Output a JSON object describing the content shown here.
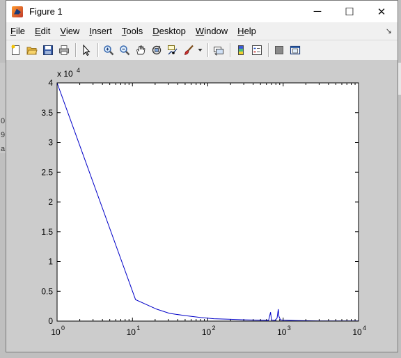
{
  "window": {
    "title": "Figure 1",
    "controls": {
      "minimize": "─",
      "maximize": "☐",
      "close": "✕"
    }
  },
  "menu": [
    {
      "prefix": "",
      "key": "F",
      "rest": "ile"
    },
    {
      "prefix": "",
      "key": "E",
      "rest": "dit"
    },
    {
      "prefix": "",
      "key": "V",
      "rest": "iew"
    },
    {
      "prefix": "",
      "key": "I",
      "rest": "nsert"
    },
    {
      "prefix": "",
      "key": "T",
      "rest": "ools"
    },
    {
      "prefix": "",
      "key": "D",
      "rest": "esktop"
    },
    {
      "prefix": "",
      "key": "W",
      "rest": "indow"
    },
    {
      "prefix": "",
      "key": "H",
      "rest": "elp"
    }
  ],
  "toolbar": {
    "buttons": [
      "new-figure-icon",
      "open-file-icon",
      "save-icon",
      "print-icon",
      "|",
      "edit-plot-arrow-icon",
      "|",
      "zoom-in-icon",
      "zoom-out-icon",
      "pan-hand-icon",
      "rotate-3d-icon",
      "data-cursor-icon",
      "brush-icon",
      "brush-dropdown-icon",
      "|",
      "link-plot-icon",
      "|",
      "insert-colorbar-icon",
      "insert-legend-icon",
      "|",
      "hide-plot-tools-icon",
      "show-plot-tools-icon"
    ]
  },
  "background_fragments": [
    "0",
    "9",
    "a"
  ],
  "chart_data": {
    "type": "line",
    "title": "",
    "xlabel": "",
    "ylabel": "",
    "xscale": "log",
    "xlim": [
      1,
      10000
    ],
    "ylim": [
      0,
      40000
    ],
    "y_exponent_label": "x 10",
    "y_exponent_power": "4",
    "yticks": [
      0,
      0.5,
      1,
      1.5,
      2,
      2.5,
      3,
      3.5,
      4
    ],
    "ytick_labels": [
      "0",
      "0.5",
      "1",
      "1.5",
      "2",
      "2.5",
      "3",
      "3.5",
      "4"
    ],
    "xticks": [
      1,
      10,
      100,
      1000,
      10000
    ],
    "xtick_base": "10",
    "xtick_powers": [
      "0",
      "1",
      "2",
      "3",
      "4"
    ],
    "grid": false,
    "series": [
      {
        "color": "#0000c8",
        "points": [
          [
            1,
            40000
          ],
          [
            11,
            3600
          ],
          [
            21,
            2000
          ],
          [
            31,
            1300
          ],
          [
            51,
            900
          ],
          [
            81,
            600
          ],
          [
            120,
            400
          ],
          [
            200,
            300
          ],
          [
            300,
            220
          ],
          [
            500,
            150
          ],
          [
            640,
            120
          ],
          [
            680,
            1500
          ],
          [
            700,
            150
          ],
          [
            780,
            120
          ],
          [
            830,
            500
          ],
          [
            860,
            2000
          ],
          [
            880,
            800
          ],
          [
            920,
            200
          ],
          [
            1000,
            150
          ],
          [
            1500,
            80
          ],
          [
            2000,
            60
          ],
          [
            3000,
            40
          ],
          [
            5000,
            30
          ],
          [
            10000,
            20
          ]
        ]
      }
    ]
  }
}
